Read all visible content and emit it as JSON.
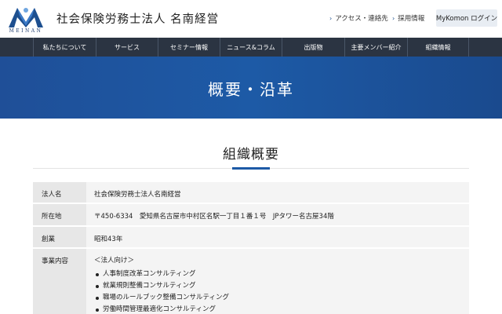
{
  "header": {
    "logo_text": "MEINAN",
    "company_name": "社会保険労務士法人 名南経営",
    "links": [
      {
        "label": "アクセス・連絡先"
      },
      {
        "label": "採用情報"
      }
    ],
    "mykomon_label": "MyKomon ログイン"
  },
  "nav": {
    "items": [
      {
        "label": "私たちについて"
      },
      {
        "label": "サービス"
      },
      {
        "label": "セミナー情報"
      },
      {
        "label": "ニュース&コラム"
      },
      {
        "label": "出版物"
      },
      {
        "label": "主要メンバー紹介"
      },
      {
        "label": "組織情報"
      }
    ]
  },
  "hero": {
    "title": "概要・沿革"
  },
  "section": {
    "title": "組織概要"
  },
  "table": {
    "rows": [
      {
        "label": "法人名",
        "value": "社会保険労務士法人名南経営"
      },
      {
        "label": "所在地",
        "value": "〒450-6334　愛知県名古屋市中村区名駅一丁目１番１号　JPタワー名古屋34階"
      },
      {
        "label": "創業",
        "value": "昭和43年"
      },
      {
        "label": "事業内容",
        "sub_heading": "＜法人向け＞",
        "bullets": [
          "人事制度改革コンサルティング",
          "就業規則整備コンサルティング",
          "職場のルールブック整備コンサルティング",
          "労働時間管理最適化コンサルティング"
        ]
      }
    ]
  },
  "colors": {
    "nav_bg": "#2b3442",
    "hero_bg": "#1d5aa6",
    "accent": "#1d5aa6",
    "label_bg": "#e7e7e7",
    "value_bg": "#f4f4f4"
  }
}
